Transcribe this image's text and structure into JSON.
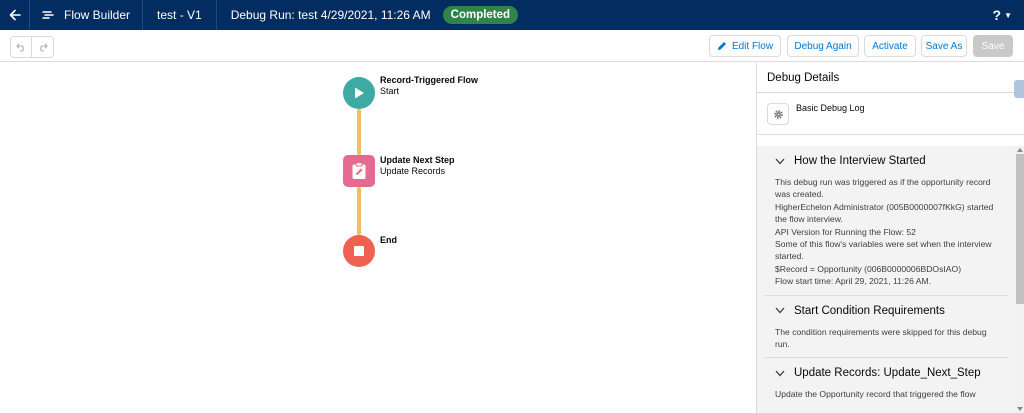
{
  "header": {
    "app_name": "Flow Builder",
    "flow_name": "test - V1",
    "run_label": "Debug Run: test 4/29/2021, 11:26 AM",
    "status_badge": "Completed",
    "help_label": "?"
  },
  "toolbar": {
    "edit_flow": "Edit Flow",
    "debug_again": "Debug Again",
    "activate": "Activate",
    "save_as": "Save As",
    "save": "Save"
  },
  "canvas": {
    "nodes": [
      {
        "title": "Record-Triggered Flow",
        "subtitle": "Start"
      },
      {
        "title": "Update Next Step",
        "subtitle": "Update Records"
      },
      {
        "title": "End",
        "subtitle": ""
      }
    ]
  },
  "panel": {
    "title": "Debug Details",
    "option_label": "Basic Debug Log",
    "sections": [
      {
        "title": "How the Interview Started",
        "lines": [
          "This debug run was triggered as if the opportunity record was created.",
          "HigherEchelon Administrator (005B0000007fKkG) started the flow interview.",
          "API Version for Running the Flow: 52",
          "Some of this flow's variables were set when the interview started.",
          "$Record = Opportunity (006B0000006BDOsIAO)",
          "Flow start time: April 29, 2021, 11:26 AM."
        ]
      },
      {
        "title": "Start Condition Requirements",
        "lines": [
          "The condition requirements were skipped for this debug run."
        ]
      },
      {
        "title": "Update Records: Update_Next_Step",
        "lines": [
          "Update the Opportunity record that triggered the flow"
        ]
      }
    ]
  },
  "colors": {
    "header_bg": "#032d60",
    "status_green": "#2e844a",
    "start_node": "#3fa9a3",
    "update_node": "#e46b8f",
    "end_node": "#ef6150",
    "connector": "#f4bc66",
    "link_blue": "#0176d3"
  }
}
